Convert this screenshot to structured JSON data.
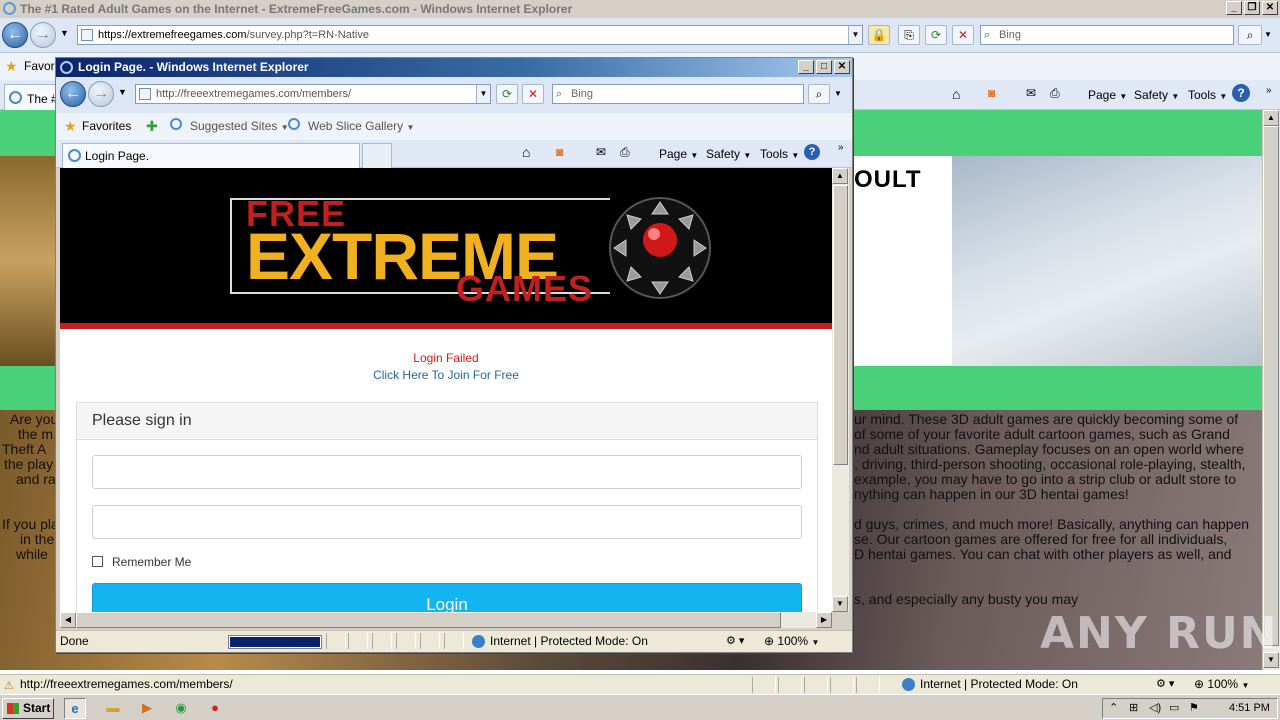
{
  "bg_window": {
    "title": "The #1 Rated Adult Games on the Internet - ExtremeFreeGames.com - Windows Internet Explorer",
    "address_host": "https://extremefreegames.com",
    "address_path": "/survey.php?t=RN-Native",
    "search_placeholder": "Bing",
    "fav_label": "Favori",
    "tab_label": "The #",
    "commands": [
      "Page",
      "Safety",
      "Tools"
    ],
    "heading_fragment": "OULT",
    "paragraph_lines_left": [
      "Are you",
      "the m",
      "Theft A",
      "the play",
      "and ra"
    ],
    "paragraph_lines_right": [
      "ur mind. These 3D adult games are quickly becoming some of",
      "of some of your favorite adult cartoon games, such as Grand",
      "nd adult situations. Gameplay focuses on an open world where",
      ", driving, third-person shooting, occasional role-playing, stealth,",
      "example, you may have to go into a strip club or adult store to",
      "nything can happen in our 3D hentai games!"
    ],
    "paragraph2_left": [
      "If you pla",
      "in the",
      "while"
    ],
    "paragraph2_right": [
      "d guys, crimes, and much more! Basically, anything can happen",
      "se. Our cartoon games are offered for free for all individuals,",
      "D hentai games. You can chat with other players as well, and"
    ],
    "paragraph3_right": "s, and especially any busty you may"
  },
  "bg_status": {
    "url": "http://freeextremegames.com/members/",
    "zone": "Internet | Protected Mode: On",
    "zoom": "100%"
  },
  "taskbar": {
    "start": "Start",
    "time": "4:51 PM"
  },
  "popup": {
    "title": "Login Page. - Windows Internet Explorer",
    "address_host": "http://freeextremegames.com",
    "address_path": "/members/",
    "search_placeholder": "Bing",
    "favorites": "Favorites",
    "suggested_sites": "Suggested Sites",
    "web_slice": "Web Slice Gallery",
    "tab_label": "Login Page.",
    "commands": [
      "Page",
      "Safety",
      "Tools"
    ],
    "status_text": "Done",
    "zone": "Internet | Protected Mode: On",
    "zoom": "100%",
    "progress": 1.0
  },
  "site": {
    "logo_free": "FREE",
    "logo_extreme": "EXTREME",
    "logo_games": "GAMES",
    "login_failed": "Login Failed",
    "join_link": "Click Here To Join For Free",
    "panel_title": "Please sign in",
    "username_placeholder": "",
    "password_placeholder": "",
    "remember_label": "Remember Me",
    "login_button": "Login"
  },
  "watermark": "ANY RUN",
  "colors": {
    "green_band": "#4bd07a",
    "login_button": "#12b5ef",
    "error_red": "#c81e1e",
    "link_blue": "#2a6496"
  }
}
